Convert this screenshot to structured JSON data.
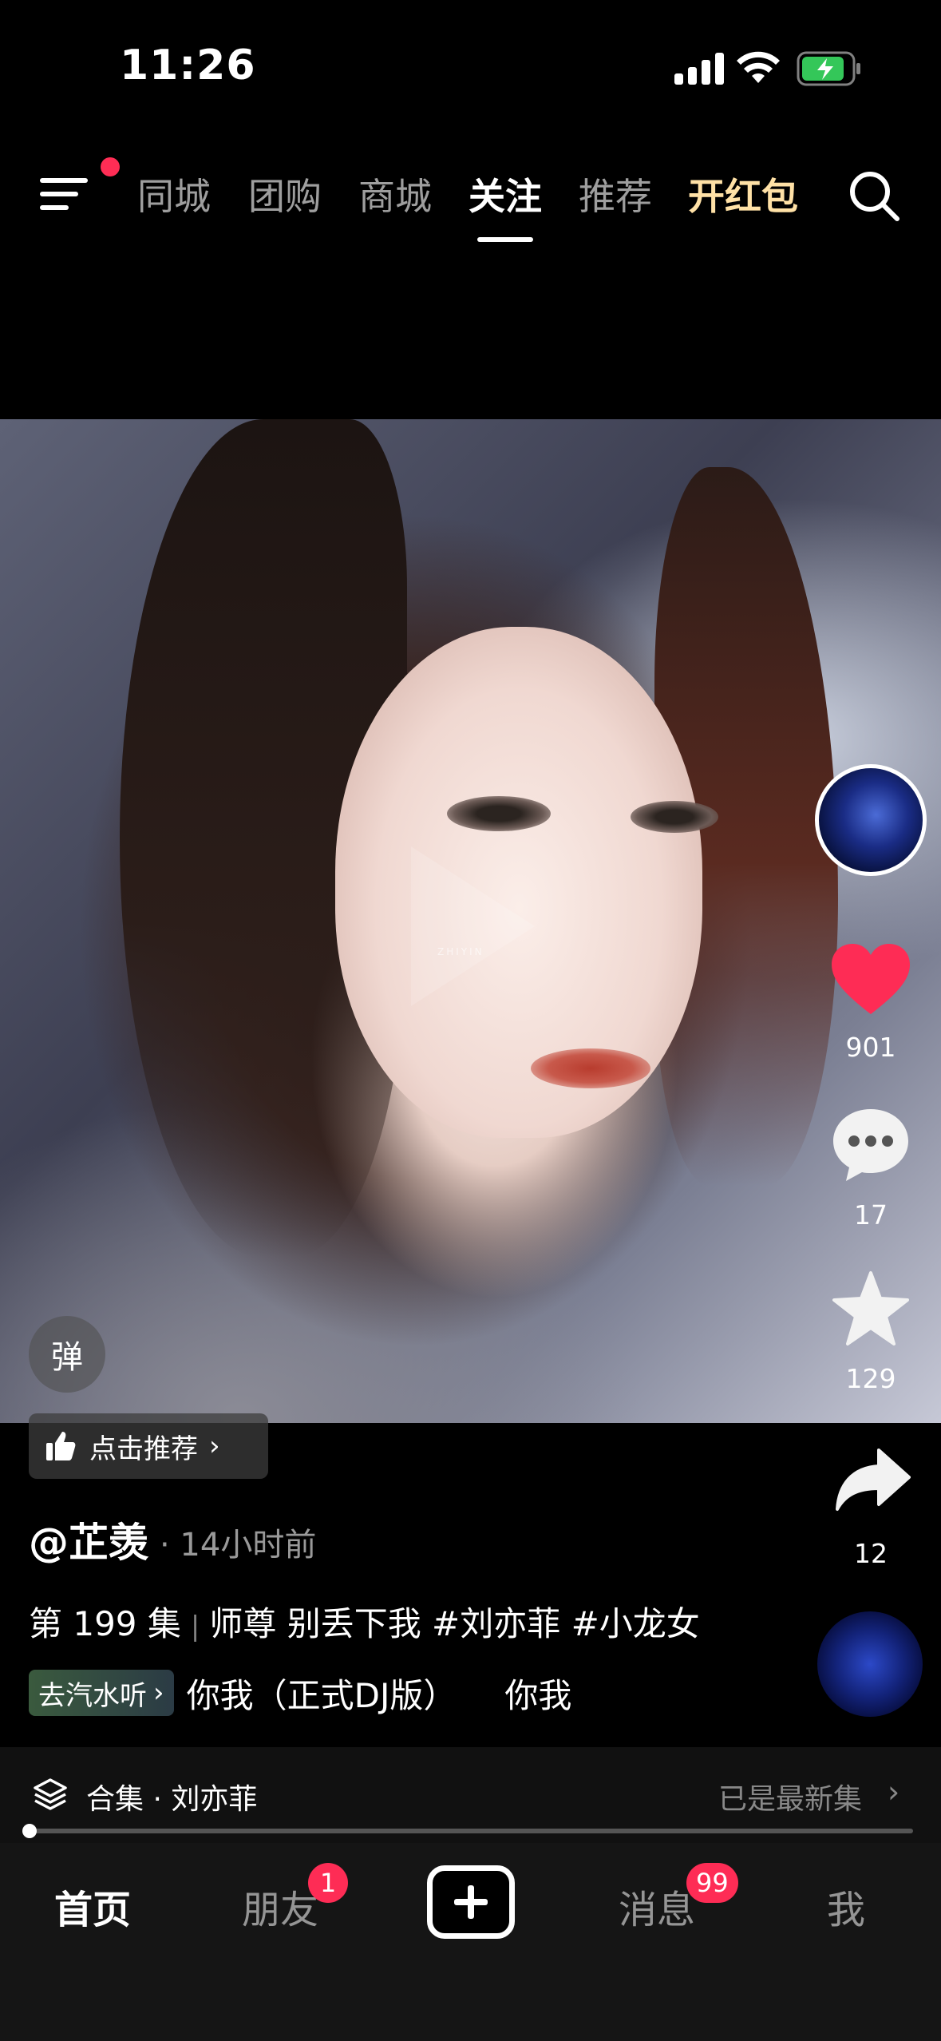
{
  "status_bar": {
    "time": "11:26"
  },
  "top_nav": {
    "tabs": [
      {
        "label": "同城"
      },
      {
        "label": "团购"
      },
      {
        "label": "商城"
      },
      {
        "label": "关注"
      },
      {
        "label": "推荐"
      },
      {
        "label": "开红包"
      }
    ],
    "active_tab": "关注"
  },
  "video": {
    "watermark": "ZHIYIN"
  },
  "rail": {
    "likes": "901",
    "comments": "17",
    "favorites": "129",
    "shares": "12"
  },
  "overlay": {
    "danmaku": "弹",
    "recommend_label": "点击推荐"
  },
  "caption": {
    "author": "@芷羡",
    "time_ago": "· 14小时前",
    "episode": "第 199 集",
    "title": "师尊 别丢下我 #刘亦菲 #小龙女",
    "music_badge": "去汽水听",
    "music_title": "你我（正式DJ版）",
    "music_title_repeat": "你我"
  },
  "collection": {
    "label": "合集 · 刘亦菲",
    "latest": "已是最新集"
  },
  "tab_bar": {
    "home": "首页",
    "friends": "朋友",
    "friends_badge": "1",
    "messages": "消息",
    "messages_badge": "99",
    "me": "我"
  },
  "colors": {
    "accent_red": "#fe2c55",
    "gold_tab": "#ffe1a6",
    "like_heart": "#fe2c55"
  }
}
